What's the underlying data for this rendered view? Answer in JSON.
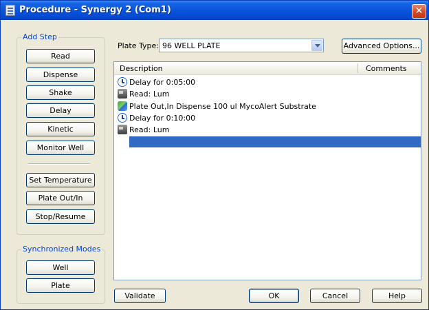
{
  "window": {
    "title": "Procedure - Synergy 2 (Com1)",
    "close_glyph": "✕"
  },
  "add_step": {
    "label": "Add Step",
    "buttons": [
      "Read",
      "Dispense",
      "Shake",
      "Delay",
      "Kinetic",
      "Monitor Well",
      "Set Temperature",
      "Plate Out/In",
      "Stop/Resume"
    ]
  },
  "sync_modes": {
    "label": "Synchronized Modes",
    "buttons": [
      "Well",
      "Plate"
    ]
  },
  "plate_type": {
    "label": "Plate Type:",
    "value": "96 WELL PLATE"
  },
  "advanced_options_label": "Advanced Options...",
  "steps_list": {
    "headers": {
      "description": "Description",
      "comments": "Comments"
    },
    "rows": [
      {
        "icon": "clock-icon",
        "text": "Delay for 0:05:00"
      },
      {
        "icon": "reader-icon",
        "text": "Read:  Lum"
      },
      {
        "icon": "plate-transfer-icon",
        "text": "Plate Out,In   Dispense 100 ul MycoAlert Substrate"
      },
      {
        "icon": "clock-icon",
        "text": "Delay for 0:10:00"
      },
      {
        "icon": "reader-icon",
        "text": "Read:  Lum"
      }
    ]
  },
  "footer": {
    "validate": "Validate",
    "ok": "OK",
    "cancel": "Cancel",
    "help": "Help"
  },
  "colors": {
    "title_bar": "#0a55dc",
    "selection": "#316ac5",
    "group_label": "#0046d5",
    "close_button": "#d1451f"
  }
}
